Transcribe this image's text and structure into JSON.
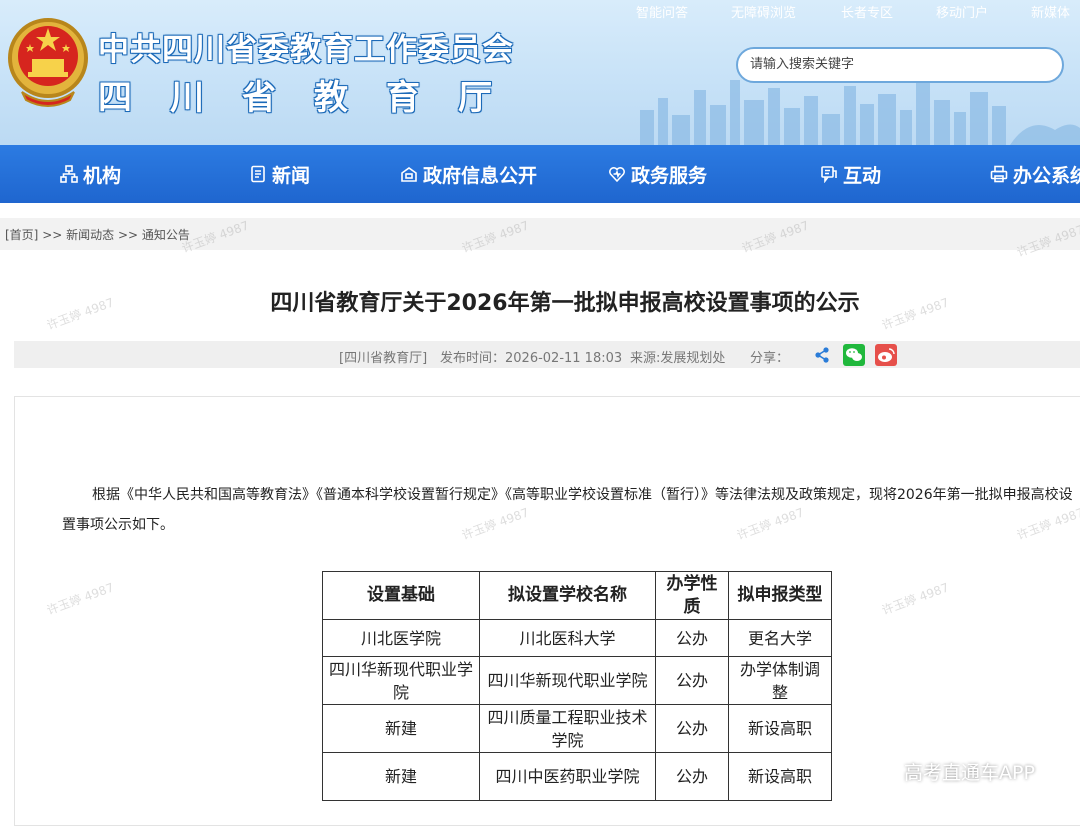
{
  "header": {
    "title_line1": "中共四川省委教育工作委员会",
    "title_line2": "四川省教育厅",
    "top_links": [
      "智能问答",
      "无障碍浏览",
      "长者专区",
      "移动门户",
      "新媒体"
    ],
    "search_placeholder": "请输入搜索关键字"
  },
  "nav": {
    "items": [
      {
        "label": "机构",
        "icon": "org-icon"
      },
      {
        "label": "新闻",
        "icon": "news-icon"
      },
      {
        "label": "政府信息公开",
        "icon": "info-open-icon"
      },
      {
        "label": "政务服务",
        "icon": "heart-service-icon"
      },
      {
        "label": "互动",
        "icon": "chat-icon"
      },
      {
        "label": "办公系统",
        "icon": "printer-icon"
      }
    ]
  },
  "breadcrumb": {
    "home": "[首页]",
    "sep": ">>",
    "level1": "新闻动态",
    "level2": "通知公告"
  },
  "article": {
    "title": "四川省教育厅关于2026年第一批拟申报高校设置事项的公示",
    "source_tag": "[四川省教育厅]",
    "publish_time": "发布时间：2026-02-11 18:03",
    "source": "来源:发展规划处",
    "share_label": "分享：",
    "share_icons": [
      "share-icon",
      "wechat-icon",
      "weibo-icon"
    ],
    "paragraph": "根据《中华人民共和国高等教育法》《普通本科学校设置暂行规定》《高等职业学校设置标准（暂行）》等法律法规及政策规定，现将2026年第一批拟申报高校设置事项公示如下。"
  },
  "table": {
    "headers": [
      "设置基础",
      "拟设置学校名称",
      "办学性质",
      "拟申报类型"
    ],
    "rows": [
      [
        "川北医学院",
        "川北医科大学",
        "公办",
        "更名大学"
      ],
      [
        "四川华新现代职业学院",
        "四川华新现代职业学院",
        "公办",
        "办学体制调整"
      ],
      [
        "新建",
        "四川质量工程职业技术学院",
        "公办",
        "新设高职"
      ],
      [
        "新建",
        "四川中医药职业学院",
        "公办",
        "新设高职"
      ]
    ]
  },
  "watermark_text": "许玉婷 4987",
  "app_mark": "高考直通车APP",
  "colors": {
    "nav_blue": "#2272d9",
    "header_sky": "#c6e1f7",
    "wechat_green": "#20b83c",
    "weibo_red": "#e6504b",
    "share_blue": "#2a7cd8"
  }
}
